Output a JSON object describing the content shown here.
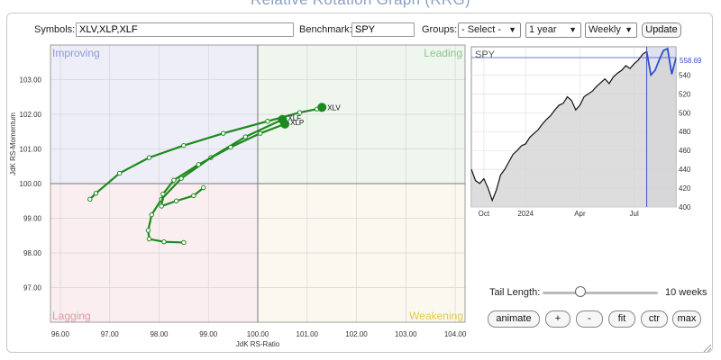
{
  "page": {
    "title": "Relative Rotation Graph (RRG)"
  },
  "controls": {
    "symbols_label": "Symbols:",
    "symbols_value": "XLV,XLP,XLF",
    "benchmark_label": "Benchmark:",
    "benchmark_value": "SPY",
    "groups_label": "Groups:",
    "groups_value": "- Select -",
    "period_value": "1 year",
    "frequency_value": "Weekly",
    "update_label": "Update"
  },
  "rrg": {
    "quadrants": {
      "improving": "Improving",
      "leading": "Leading",
      "lagging": "Lagging",
      "weakening": "Weakening",
      "colors": {
        "improving": "#eeeef8",
        "leading": "#eef6ee",
        "lagging": "#faeef0",
        "weakening": "#fbf9ef"
      },
      "label_colors": {
        "improving": "#8e99d6",
        "leading": "#8ec48e",
        "lagging": "#e29aa2",
        "weakening": "#e8c64a"
      }
    },
    "tail_color": "#1d8a1d"
  },
  "chart_data": [
    {
      "type": "scatter",
      "title": "",
      "xlabel": "JdK RS-Ratio",
      "ylabel": "JdK RS-Momentum",
      "xlim": [
        95.8,
        104.2
      ],
      "ylim": [
        96.0,
        104.0
      ],
      "xticks": [
        96.0,
        97.0,
        98.0,
        99.0,
        100.0,
        101.0,
        102.0,
        103.0,
        104.0
      ],
      "yticks": [
        97.0,
        98.0,
        99.0,
        100.0,
        101.0,
        102.0,
        103.0
      ],
      "xtick_labels": [
        "96.00",
        "97.00",
        "98.00",
        "99.00",
        "100.00",
        "101.00",
        "102.00",
        "103.00",
        "104.00"
      ],
      "ytick_labels": [
        "97.00",
        "98.00",
        "99.00",
        "100.00",
        "101.00",
        "102.00",
        "103.00"
      ],
      "center": [
        100,
        100
      ],
      "grid": true,
      "series": [
        {
          "name": "XLV",
          "x": [
            96.6,
            96.72,
            97.2,
            97.8,
            98.5,
            99.3,
            100.2,
            100.85,
            101.2,
            101.3
          ],
          "y": [
            99.55,
            99.72,
            100.3,
            100.75,
            101.1,
            101.45,
            101.8,
            102.05,
            102.15,
            102.2
          ]
        },
        {
          "name": "XLF",
          "x": [
            98.5,
            98.1,
            97.8,
            97.78,
            97.85,
            98.05,
            98.45,
            99.05,
            99.75,
            100.5
          ],
          "y": [
            98.3,
            98.32,
            98.4,
            98.65,
            99.1,
            99.55,
            100.15,
            100.75,
            101.35,
            101.85
          ]
        },
        {
          "name": "XLP",
          "x": [
            98.9,
            98.7,
            98.35,
            98.05,
            98.08,
            98.3,
            98.8,
            99.45,
            100.05,
            100.55
          ],
          "y": [
            99.88,
            99.65,
            99.5,
            99.35,
            99.7,
            100.1,
            100.55,
            101.05,
            101.45,
            101.72
          ]
        }
      ]
    },
    {
      "type": "line",
      "title": "SPY",
      "last_value_label": "558.69",
      "ylim": [
        400,
        570
      ],
      "yticks": [
        400,
        420,
        440,
        460,
        480,
        500,
        520,
        540
      ],
      "ytick_labels": [
        "400",
        "420",
        "440",
        "460",
        "480",
        "500",
        "520",
        "540"
      ],
      "xtick_labels": [
        "Oct",
        "2024",
        "Apr",
        "Jul"
      ],
      "xtick_positions": [
        3,
        13,
        26,
        39
      ],
      "highlight_start_index": 42,
      "fill_color": "#d4d4d4",
      "highlight_color": "#c9cbe5",
      "series": [
        {
          "name": "SPY",
          "values": [
            440,
            428,
            425,
            430,
            420,
            407,
            418,
            434,
            440,
            448,
            456,
            460,
            465,
            467,
            474,
            478,
            482,
            488,
            493,
            497,
            503,
            508,
            510,
            517,
            513,
            503,
            508,
            517,
            520,
            523,
            528,
            532,
            536,
            531,
            538,
            542,
            545,
            550,
            547,
            552,
            556,
            562,
            565,
            540,
            545,
            556,
            566,
            568,
            541,
            558
          ]
        }
      ]
    }
  ],
  "tail": {
    "label": "Tail Length:",
    "value_label": "10 weeks",
    "fraction": 0.33
  },
  "actions": {
    "animate": "animate",
    "plus": "+",
    "minus": "-",
    "fit": "fit",
    "ctr": "ctr",
    "max": "max"
  }
}
